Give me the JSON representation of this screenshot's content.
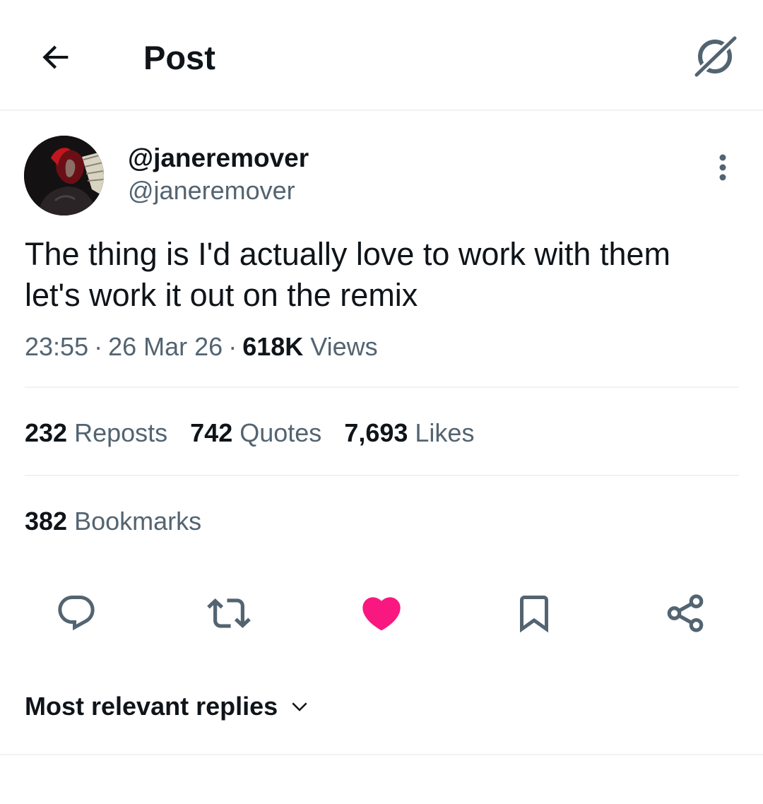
{
  "header": {
    "title": "Post",
    "back_icon": "arrow-left-icon",
    "grok_icon": "grok-icon"
  },
  "author": {
    "display_name": "@janeremover",
    "handle": "@janeremover",
    "more_icon": "more-vertical-icon"
  },
  "post": {
    "text": "The thing is I'd actually love to work with them\nlet's work it out on the remix",
    "time": "23:55",
    "date": "26 Mar 26",
    "views_count": "618K",
    "views_label": "Views",
    "separator": "·"
  },
  "stats": {
    "reposts": {
      "count": "232",
      "label": "Reposts"
    },
    "quotes": {
      "count": "742",
      "label": "Quotes"
    },
    "likes": {
      "count": "7,693",
      "label": "Likes"
    },
    "bookmarks": {
      "count": "382",
      "label": "Bookmarks"
    }
  },
  "actions": {
    "reply_icon": "reply-icon",
    "repost_icon": "repost-icon",
    "like_icon": "heart-filled-icon",
    "bookmark_icon": "bookmark-icon",
    "share_icon": "share-icon",
    "liked": true
  },
  "replies": {
    "sort_label": "Most relevant replies",
    "chevron_icon": "chevron-down-icon"
  },
  "colors": {
    "text_primary": "#0f1419",
    "text_secondary": "#536471",
    "divider": "#eff3f4",
    "like_active": "#f91880"
  }
}
